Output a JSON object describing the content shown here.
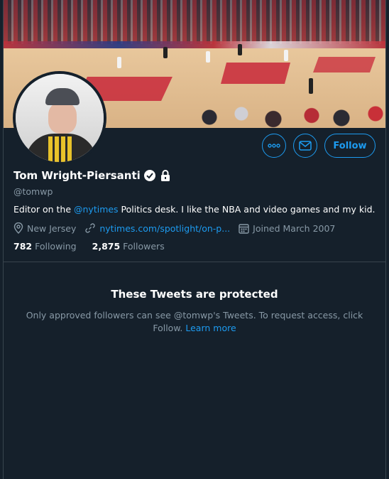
{
  "profile": {
    "name": "Tom Wright-Piersanti",
    "handle": "@tomwp",
    "bio": {
      "before": "Editor on the ",
      "mention": "@nytimes",
      "after": " Politics desk. I like the NBA and video games and my kid."
    },
    "location": "New Jersey",
    "website": "nytimes.com/spotlight/on-p...",
    "joined": "Joined March 2007",
    "following_count": "782",
    "following_label": "Following",
    "followers_count": "2,875",
    "followers_label": "Followers"
  },
  "actions": {
    "more_icon": "ooo",
    "message_icon": "envelope-icon",
    "follow_label": "Follow"
  },
  "protected": {
    "title": "These Tweets are protected",
    "body": "Only approved followers can see @tomwp's Tweets. To request access, click Follow.",
    "learn_more": "Learn more"
  },
  "colors": {
    "background": "#15202b",
    "accent": "#1d9bf0",
    "secondary_text": "#8899a6",
    "border": "#38444d"
  }
}
